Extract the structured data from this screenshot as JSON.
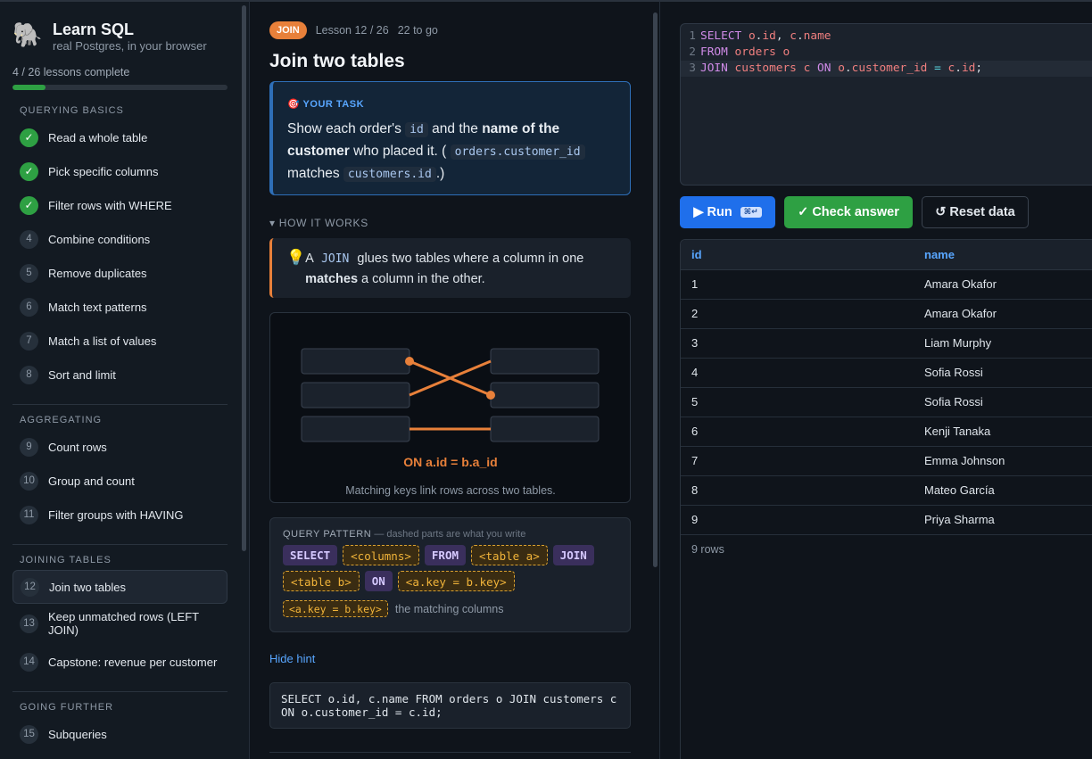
{
  "sidebar": {
    "logo_emoji": "🐘",
    "title": "Learn SQL",
    "subtitle": "real Postgres, in your browser",
    "progress_text": "4 / 26 lessons complete",
    "progress_fraction": 0.154,
    "accent_color": "#2ea043",
    "sections": [
      {
        "title": "QUERYING BASICS",
        "items": [
          {
            "badge": "✓",
            "done": true,
            "label": "Read a whole table"
          },
          {
            "badge": "✓",
            "done": true,
            "label": "Pick specific columns"
          },
          {
            "badge": "✓",
            "done": true,
            "label": "Filter rows with WHERE"
          },
          {
            "badge": "4",
            "done": false,
            "label": "Combine conditions"
          },
          {
            "badge": "5",
            "done": false,
            "label": "Remove duplicates"
          },
          {
            "badge": "6",
            "done": false,
            "label": "Match text patterns"
          },
          {
            "badge": "7",
            "done": false,
            "label": "Match a list of values"
          },
          {
            "badge": "8",
            "done": false,
            "label": "Sort and limit"
          }
        ]
      },
      {
        "title": "AGGREGATING",
        "items": [
          {
            "badge": "9",
            "done": false,
            "label": "Count rows"
          },
          {
            "badge": "10",
            "done": false,
            "label": "Group and count"
          },
          {
            "badge": "11",
            "done": false,
            "label": "Filter groups with HAVING"
          }
        ]
      },
      {
        "title": "JOINING TABLES",
        "items": [
          {
            "badge": "12",
            "done": false,
            "label": "Join two tables",
            "active": true
          },
          {
            "badge": "13",
            "done": false,
            "label": "Keep unmatched rows (LEFT JOIN)"
          },
          {
            "badge": "14",
            "done": false,
            "label": "Capstone: revenue per customer"
          }
        ]
      },
      {
        "title": "GOING FURTHER",
        "items": [
          {
            "badge": "15",
            "done": false,
            "label": "Subqueries"
          }
        ]
      }
    ]
  },
  "lesson": {
    "tag": "JOIN",
    "position": "Lesson 12 / 26",
    "remaining": "22 to go",
    "title": "Join two tables",
    "task_head": "🎯 YOUR TASK",
    "task": {
      "t1": "Show each order's ",
      "c1": "id",
      "t2": " and the ",
      "b1": "name of the customer",
      "t3": " who placed it. ( ",
      "c2": "orders.customer_id",
      "t4": " matches ",
      "c3": "customers.id",
      "t5": ".)"
    },
    "how_toggle": "▾ HOW IT WORKS",
    "callout": {
      "icon": "💡",
      "t1": "A ",
      "code": "JOIN",
      "t2": " glues two tables where a column in one ",
      "bold": "matches",
      "t3": " a column in the other."
    },
    "diagram": {
      "label": "ON a.id = b.a_id",
      "caption": "Matching keys link rows across two tables.",
      "link_color": "#e8803a"
    },
    "pattern": {
      "head": "QUERY PATTERN",
      "sub": " — dashed parts are what you write",
      "tokens": [
        {
          "text": "SELECT",
          "kind": "kw"
        },
        {
          "text": "<columns>",
          "kind": "ph"
        },
        {
          "text": "FROM",
          "kind": "kw"
        },
        {
          "text": "<table a>",
          "kind": "ph"
        },
        {
          "text": "JOIN",
          "kind": "kw"
        },
        {
          "text": "<table b>",
          "kind": "ph"
        },
        {
          "text": "ON",
          "kind": "kw"
        },
        {
          "text": "<a.key = b.key>",
          "kind": "ph"
        }
      ],
      "legend_token": "<a.key = b.key>",
      "legend_text": "the matching columns"
    },
    "hide_hint": "Hide hint",
    "hint_code": "SELECT o.id, c.name FROM orders o JOIN customers c ON o.customer_id = c.id;"
  },
  "editor": {
    "lines": [
      {
        "n": "1",
        "tokens": [
          [
            "kw2",
            "SELECT"
          ],
          [
            "pl",
            " "
          ],
          [
            "id2",
            "o"
          ],
          [
            "pl",
            "."
          ],
          [
            "id2",
            "id"
          ],
          [
            "pl",
            ", "
          ],
          [
            "id2",
            "c"
          ],
          [
            "pl",
            "."
          ],
          [
            "id2",
            "name"
          ]
        ]
      },
      {
        "n": "2",
        "tokens": [
          [
            "kw2",
            "FROM"
          ],
          [
            "pl",
            " "
          ],
          [
            "id2",
            "orders"
          ],
          [
            "pl",
            " "
          ],
          [
            "id2",
            "o"
          ]
        ]
      },
      {
        "n": "3",
        "tokens": [
          [
            "kw2",
            "JOIN"
          ],
          [
            "pl",
            " "
          ],
          [
            "id2",
            "customers"
          ],
          [
            "pl",
            " "
          ],
          [
            "id2",
            "c"
          ],
          [
            "pl",
            " "
          ],
          [
            "kw2",
            "ON"
          ],
          [
            "pl",
            " "
          ],
          [
            "id2",
            "o"
          ],
          [
            "pl",
            "."
          ],
          [
            "id2",
            "customer_id"
          ],
          [
            "pl",
            " "
          ],
          [
            "op",
            "="
          ],
          [
            "pl",
            " "
          ],
          [
            "id2",
            "c"
          ],
          [
            "pl",
            "."
          ],
          [
            "id2",
            "id"
          ],
          [
            "pl",
            ";"
          ]
        ]
      }
    ]
  },
  "buttons": {
    "run": "▶ Run",
    "run_kbd": "⌘↵",
    "check": "✓ Check answer",
    "reset": "↺ Reset data"
  },
  "results": {
    "columns": [
      "id",
      "name"
    ],
    "rows": [
      [
        "1",
        "Amara Okafor"
      ],
      [
        "2",
        "Amara Okafor"
      ],
      [
        "3",
        "Liam Murphy"
      ],
      [
        "4",
        "Sofia Rossi"
      ],
      [
        "5",
        "Sofia Rossi"
      ],
      [
        "6",
        "Kenji Tanaka"
      ],
      [
        "7",
        "Emma Johnson"
      ],
      [
        "8",
        "Mateo García"
      ],
      [
        "9",
        "Priya Sharma"
      ]
    ],
    "row_count": "9 rows"
  }
}
